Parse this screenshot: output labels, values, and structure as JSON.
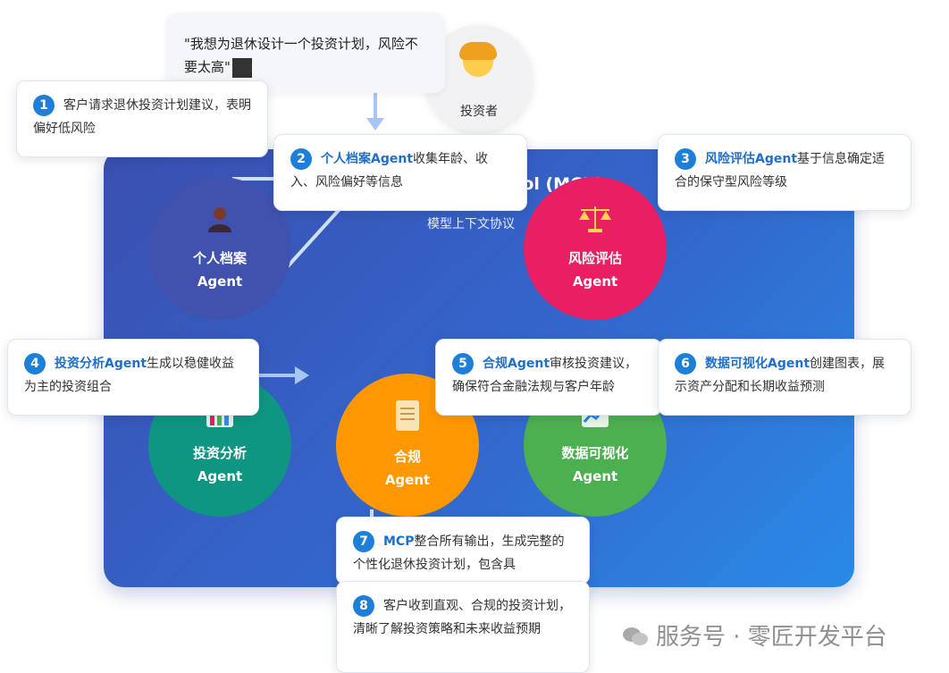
{
  "panel": {
    "title": "ocol (MCP)",
    "subtitle": "模型上下文协议"
  },
  "investor": {
    "label": "投资者",
    "icon": "woman-face-icon"
  },
  "quote": {
    "text": "\"我想为退休设计一个投资计划，风险不要太高\""
  },
  "agents": {
    "profile": {
      "name": "个人档案",
      "suffix": "Agent",
      "icon": "person-icon",
      "color": "#4052ae"
    },
    "risk": {
      "name": "风险评估",
      "suffix": "Agent",
      "icon": "scales-icon",
      "color": "#e91e63"
    },
    "invest": {
      "name": "投资分析",
      "suffix": "Agent",
      "icon": "bar-chart-icon",
      "color": "#0f9682"
    },
    "compliance": {
      "name": "合规",
      "suffix": "Agent",
      "icon": "scroll-icon",
      "color": "#ff9800"
    },
    "viz": {
      "name": "数据可视化",
      "suffix": "Agent",
      "icon": "line-chart-icon",
      "color": "#4caf50"
    }
  },
  "steps": [
    {
      "num": "1",
      "hl": "",
      "text": "客户请求退休投资计划建议，表明偏好低风险"
    },
    {
      "num": "2",
      "hl": "个人档案Agent",
      "text": "收集年龄、收入、风险偏好等信息"
    },
    {
      "num": "3",
      "hl": "风险评估Agent",
      "text": "基于信息确定适合的保守型风险等级"
    },
    {
      "num": "4",
      "hl": "投资分析Agent",
      "text": "生成以稳健收益为主的投资组合"
    },
    {
      "num": "5",
      "hl": "合规Agent",
      "text": "审核投资建议，确保符合金融法规与客户年龄"
    },
    {
      "num": "6",
      "hl": "数据可视化Agent",
      "text": "创建图表，展示资产分配和长期收益预测"
    },
    {
      "num": "7",
      "hl": "MCP",
      "text": "整合所有输出，生成完整的个性化退休投资计划，包含具"
    },
    {
      "num": "8",
      "hl": "",
      "text": "客户收到直观、合规的投资计划，清晰了解投资策略和未来收益预期"
    }
  ],
  "watermark": {
    "text": "服务号 · 零匠开发平台"
  }
}
